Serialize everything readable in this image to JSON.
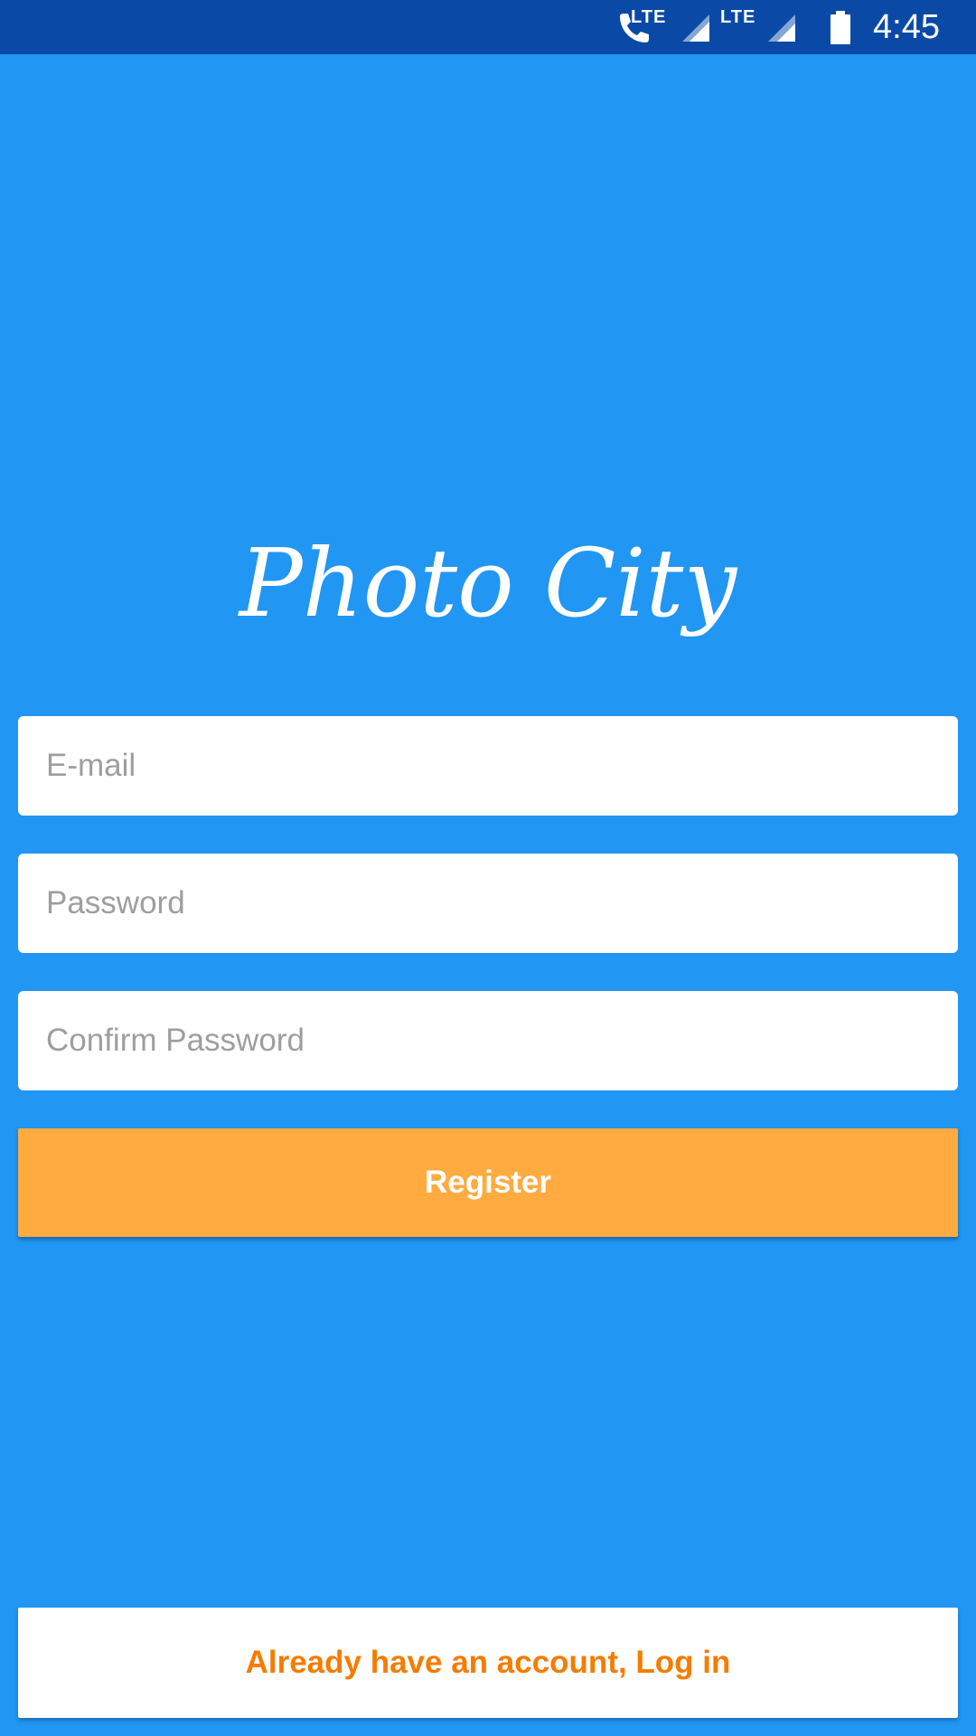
{
  "status_bar": {
    "time": "4:45",
    "lte_label_1": "LTE",
    "lte_label_2": "LTE",
    "icons": [
      "phone-lte-icon",
      "signal-icon",
      "signal-icon",
      "battery-icon"
    ]
  },
  "app": {
    "title": "Photo City"
  },
  "form": {
    "email_placeholder": "E-mail",
    "password_placeholder": "Password",
    "confirm_placeholder": "Confirm Password",
    "register_label": "Register"
  },
  "footer": {
    "prompt": "Already have an account, ",
    "link": "Log in"
  },
  "colors": {
    "background": "#2196F3",
    "status_bar": "#0A4AA6",
    "accent": "#FFAB40",
    "link": "#F57C00",
    "field_bg": "#FFFFFF"
  }
}
